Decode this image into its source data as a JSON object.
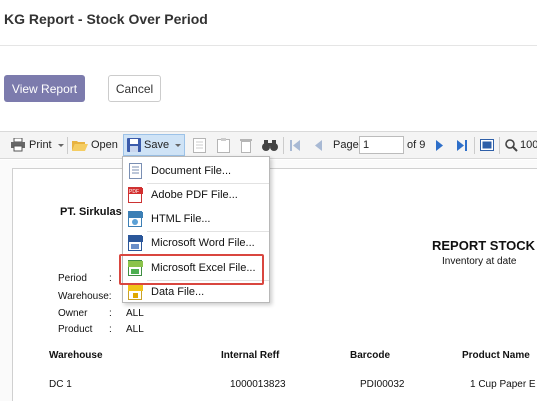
{
  "page": {
    "title": "KG Report - Stock Over Period"
  },
  "actions": {
    "view_report": "View Report",
    "cancel": "Cancel"
  },
  "toolbar": {
    "print": "Print",
    "open": "Open",
    "save": "Save",
    "page_label": "Page",
    "page_value": "1",
    "page_of": "of 9",
    "zoom_value": "100"
  },
  "save_menu": {
    "items": [
      {
        "label": "Document File...",
        "icon": "document-file-icon"
      },
      {
        "label": "Adobe PDF File...",
        "icon": "pdf-file-icon"
      },
      {
        "label": "HTML File...",
        "icon": "html-file-icon"
      },
      {
        "label": "Microsoft Word File...",
        "icon": "word-file-icon"
      },
      {
        "label": "Microsoft Excel File...",
        "icon": "excel-file-icon"
      },
      {
        "label": "Data File...",
        "icon": "data-file-icon"
      }
    ],
    "highlighted": "Microsoft Excel File..."
  },
  "report": {
    "company": "PT. Sirkulas",
    "heading": "REPORT STOCK",
    "inventory_at_date_label": "Inventory at date",
    "fields": [
      {
        "label": "Period",
        "sep": ":",
        "value": ""
      },
      {
        "label": "Warehouse:",
        "sep": "",
        "value": ""
      },
      {
        "label": "Owner",
        "sep": ":",
        "value": "ALL"
      },
      {
        "label": "Product",
        "sep": ":",
        "value": "ALL"
      }
    ],
    "columns": [
      "Warehouse",
      "Internal Reff",
      "Barcode",
      "Product Name"
    ],
    "rows": [
      [
        "DC 1",
        "1000013823",
        "PDI00032",
        "1 Cup Paper E"
      ]
    ]
  }
}
